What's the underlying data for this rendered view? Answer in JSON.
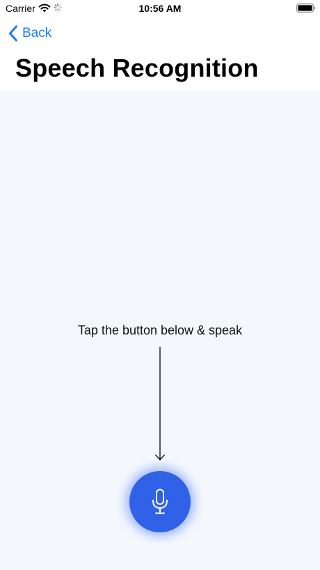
{
  "status_bar": {
    "carrier": "Carrier",
    "time": "10:56 AM",
    "wifi_icon": "wifi-icon",
    "activity_icon": "spinner-icon",
    "battery_icon": "battery-icon"
  },
  "nav": {
    "back_label": "Back",
    "title": "Speech Recognition"
  },
  "main": {
    "hint": "Tap the button below & speak",
    "mic_icon": "microphone-icon"
  },
  "colors": {
    "accent": "#1a7cf5",
    "mic_button": "#2f62e6",
    "content_background": "#f4f8fc"
  }
}
